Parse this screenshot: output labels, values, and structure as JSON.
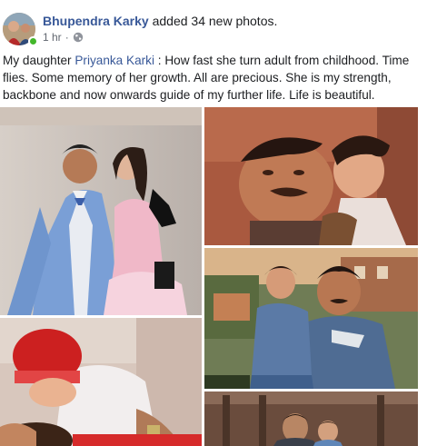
{
  "post": {
    "author": "Bhupendra Karky",
    "action": "added 34 new photos.",
    "time": "1 hr",
    "separator": "·",
    "privacy_icon": "globe-icon",
    "caption_prefix": "My daughter ",
    "mention": "Priyanka Karki",
    "caption_rest": " : How fast she turn adult from childhood. Time flies. Some memory of her growth. All are precious. She is my strength, backbone and now onwards guide of my further life. Life is beautiful."
  },
  "photos": [
    {
      "name": "photo-father-daughter-costume"
    },
    {
      "name": "photo-father-kiss-vintage"
    },
    {
      "name": "photo-baby-red-hat"
    },
    {
      "name": "photo-father-child-denim"
    },
    {
      "name": "photo-father-child-bottom"
    }
  ],
  "colors": {
    "link": "#385898",
    "text": "#1c1e21",
    "meta": "#616770",
    "online": "#42b72a"
  }
}
